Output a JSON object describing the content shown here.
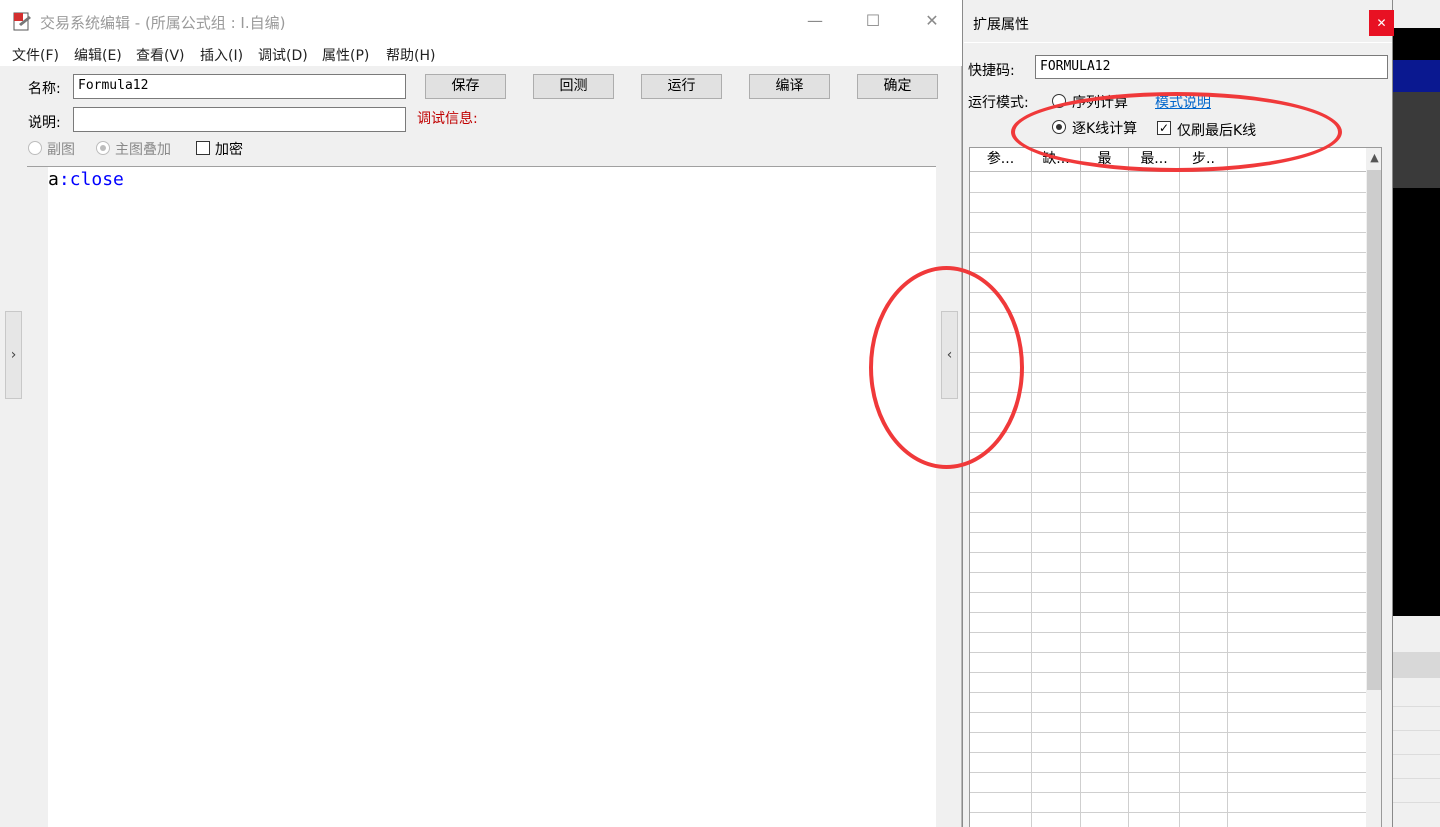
{
  "editor": {
    "title": "交易系统编辑 - (所属公式组 : I.自编)",
    "menu": [
      "文件(F)",
      "编辑(E)",
      "查看(V)",
      "插入(I)",
      "调试(D)",
      "属性(P)",
      "帮助(H)"
    ],
    "name_label": "名称:",
    "name_value": "Formula12",
    "desc_label": "说明:",
    "desc_value": "",
    "buttons": {
      "save": "保存",
      "backtest": "回测",
      "run": "运行",
      "compile": "编译",
      "ok": "确定"
    },
    "debug_label": "调试信息:",
    "options": {
      "sub_chart": "副图",
      "main_overlay": "主图叠加",
      "encrypt": "加密"
    },
    "code": {
      "var": "a",
      "sep": ":",
      "keyword": "close"
    },
    "left_toggle_icon": "›",
    "right_toggle_icon": "‹",
    "controls": {
      "minimize": "—",
      "maximize": "☐",
      "close": "✕"
    }
  },
  "props": {
    "title": "扩展属性",
    "close_icon": "✕",
    "shortcut_label": "快捷码:",
    "shortcut_value": "FORMULA12",
    "mode_label": "运行模式:",
    "mode_sequence": "序列计算",
    "mode_help_link": "模式说明",
    "mode_per_bar": "逐K线计算",
    "refresh_last_only": "仅刷最后K线",
    "columns": [
      "参...",
      "缺...",
      "最",
      "最...",
      "步.."
    ]
  },
  "annotation_color": "#f0393a"
}
